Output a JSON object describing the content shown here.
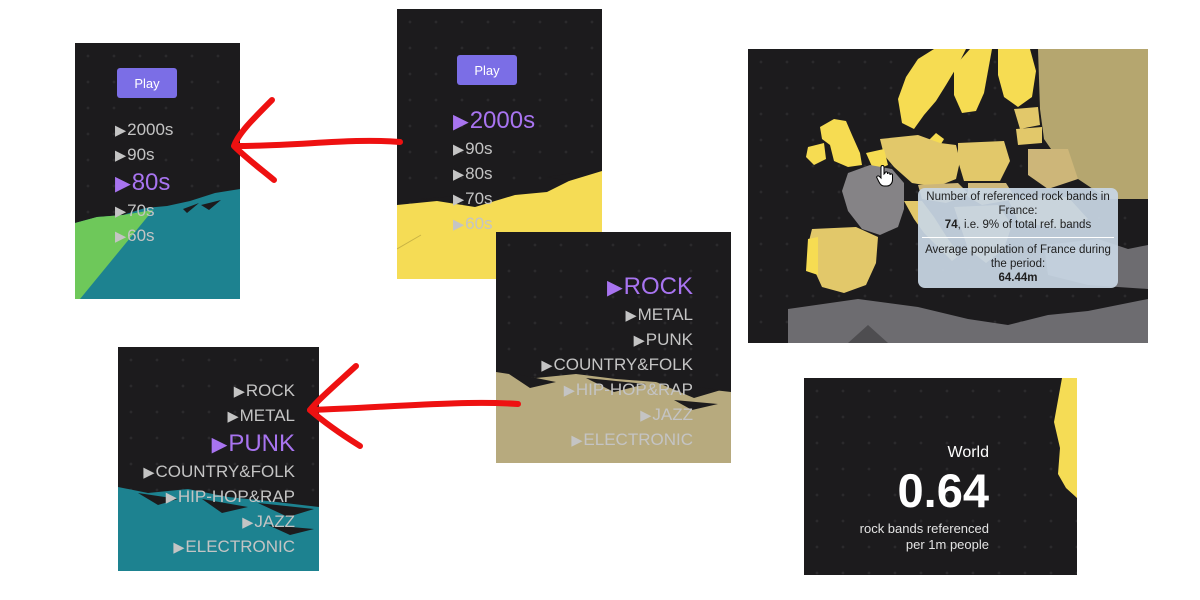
{
  "colors": {
    "panel_bg": "#1c1b1d",
    "active_item": "#a874f0",
    "inactive_item": "#c4c4c4",
    "play_button": "#7b6ee6",
    "arrow": "#ee1111",
    "teal": "#1d8290",
    "green": "#6ec85a",
    "yellow": "#f5dc55",
    "khaki": "#b7aa7e",
    "map_bright_yellow": "#f6dc52",
    "map_gold": "#e2c86a",
    "map_pale": "#cdb679",
    "map_gray": "#858386"
  },
  "panel_decades_a": {
    "play_label": "Play",
    "decades": [
      {
        "label": "2000s",
        "active": false
      },
      {
        "label": "90s",
        "active": false
      },
      {
        "label": "80s",
        "active": true
      },
      {
        "label": "70s",
        "active": false
      },
      {
        "label": "60s",
        "active": false
      }
    ]
  },
  "panel_decades_b": {
    "play_label": "Play",
    "decades": [
      {
        "label": "2000s",
        "active": true
      },
      {
        "label": "90s",
        "active": false
      },
      {
        "label": "80s",
        "active": false
      },
      {
        "label": "70s",
        "active": false
      },
      {
        "label": "60s",
        "active": false
      }
    ]
  },
  "panel_genres_a": {
    "genres": [
      {
        "label": "ROCK",
        "active": true
      },
      {
        "label": "METAL",
        "active": false
      },
      {
        "label": "PUNK",
        "active": false
      },
      {
        "label": "COUNTRY&FOLK",
        "active": false
      },
      {
        "label": "HIP-HOP&RAP",
        "active": false
      },
      {
        "label": "JAZZ",
        "active": false
      },
      {
        "label": "ELECTRONIC",
        "active": false
      }
    ]
  },
  "panel_genres_b": {
    "genres": [
      {
        "label": "ROCK",
        "active": false
      },
      {
        "label": "METAL",
        "active": false
      },
      {
        "label": "PUNK",
        "active": true
      },
      {
        "label": "COUNTRY&FOLK",
        "active": false
      },
      {
        "label": "HIP-HOP&RAP",
        "active": false
      },
      {
        "label": "JAZZ",
        "active": false
      },
      {
        "label": "ELECTRONIC",
        "active": false
      }
    ]
  },
  "map_panel": {
    "tooltip": {
      "line1": "Number of referenced rock bands in France:",
      "count": "74",
      "line2": ", i.e. 9% of total ref. bands",
      "line3": "Average population of France during the period:",
      "population": "64.44m"
    },
    "cursor_icon": "hand-pointer-icon"
  },
  "stat_panel": {
    "region": "World",
    "value": "0.64",
    "desc_line1": "rock bands referenced",
    "desc_line2": "per 1m people"
  },
  "annotations": {
    "arrow_icon": "red-arrow-icon"
  }
}
